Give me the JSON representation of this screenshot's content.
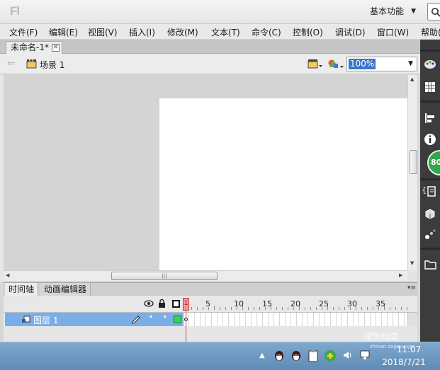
{
  "app": {
    "logo": "Fl"
  },
  "workspace": {
    "label": "基本功能"
  },
  "menu": [
    "文件(F)",
    "编辑(E)",
    "视图(V)",
    "插入(I)",
    "修改(M)",
    "文本(T)",
    "命令(C)",
    "控制(O)",
    "调试(D)",
    "窗口(W)",
    "帮助("
  ],
  "document": {
    "tab_title": "未命名-1*",
    "close_label": "✕"
  },
  "editbar": {
    "scene_label": "场景 1",
    "zoom_value": "100%"
  },
  "panels": {
    "tabs": [
      "时间轴",
      "动画编辑器"
    ]
  },
  "timeline": {
    "layer_name": "图层 1",
    "current_frame": "1",
    "frame_labels": [
      "5",
      "10",
      "15",
      "20",
      "25",
      "30",
      "35"
    ]
  },
  "side_badge": "80",
  "taskbar": {
    "time": "11:07",
    "date": "2018/7/21"
  },
  "watermark": {
    "text": "搜狗指南",
    "sub": "zhinan.sogou.com"
  },
  "colors": {
    "layer_selected": "#7aaee6",
    "playhead": "#d03030",
    "stage": "#ffffff",
    "taskbar": "#6f9ac2"
  }
}
